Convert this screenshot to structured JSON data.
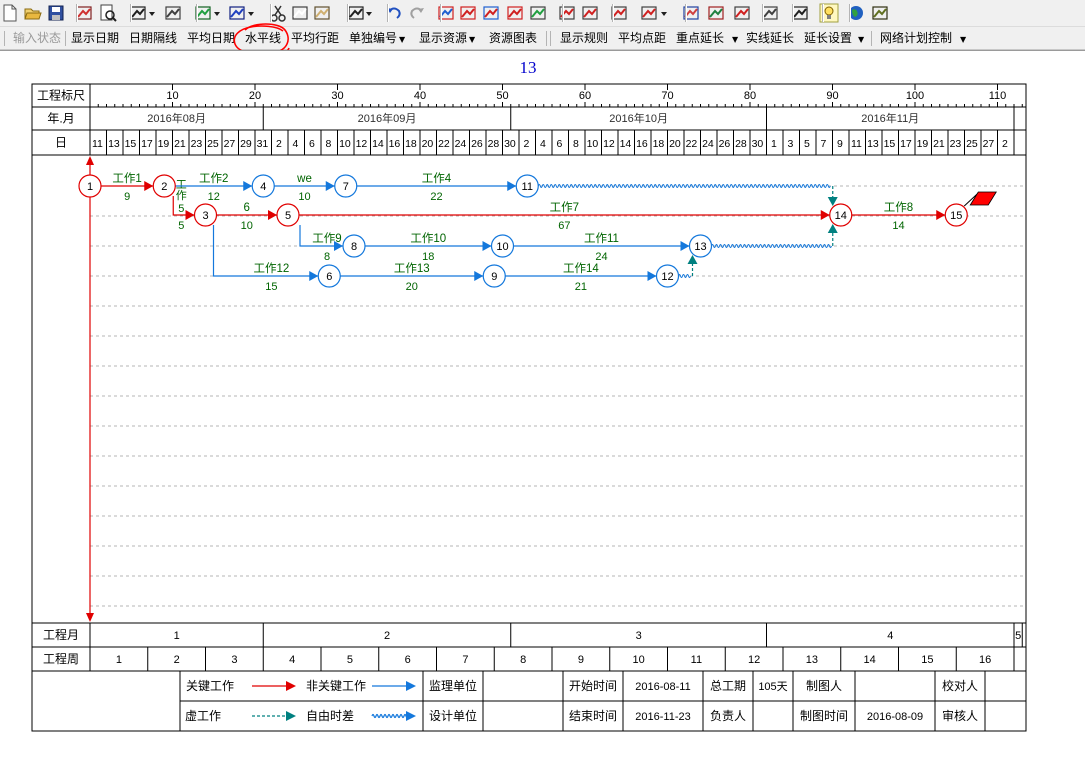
{
  "toolbar_icons": [
    "new-file-icon",
    "open-folder-icon",
    "save-icon",
    "export-icon",
    "print-preview-icon",
    "line-style-icon",
    "line-style-dropdown-icon",
    "indent-icon",
    "refresh-icon",
    "refresh-dropdown-icon",
    "check-icon",
    "check-dropdown-icon",
    "cut-icon",
    "copy-icon",
    "paste-icon",
    "find-icon",
    "find-dropdown-icon",
    "undo-icon",
    "redo-icon",
    "network-icon",
    "critical-path-icon",
    "stack-icon",
    "curve-icon",
    "resource-icon",
    "link-nodes-icon",
    "unlink-nodes-icon",
    "calendar-icon",
    "align-icon",
    "align-dropdown-icon",
    "library-icon",
    "tools-icon",
    "edit-icon",
    "screen-icon",
    "move-icon",
    "light-bulb-icon",
    "globe-icon",
    "box-icon"
  ],
  "toolbar2": {
    "input_status": "输入状态",
    "show_date": "显示日期",
    "date_divider": "日期隔线",
    "average_date": "平均日期",
    "horizontal_line": "水平线",
    "average_row_spacing": "平均行距",
    "single_numbering": "单独编号",
    "show_resources": "显示资源",
    "resource_chart": "资源图表",
    "show_rules": "显示规则",
    "average_point_spacing": "平均点距",
    "key_extend": "重点延长",
    "solid_extend": "实线延长",
    "extend_settings": "延长设置",
    "network_control": "网络计划控制"
  },
  "title": "13",
  "scale": {
    "label": "工程标尺",
    "ticks": [
      "10",
      "20",
      "30",
      "40",
      "50",
      "60",
      "70",
      "80",
      "90",
      "100",
      "110"
    ],
    "tick_values": [
      10,
      20,
      30,
      40,
      50,
      60,
      70,
      80,
      90,
      100,
      110
    ]
  },
  "year_month": {
    "label": "年.月",
    "months": [
      {
        "label": "2016年08月",
        "from": 0,
        "to": 21
      },
      {
        "label": "2016年09月",
        "from": 21,
        "to": 51
      },
      {
        "label": "2016年10月",
        "from": 51,
        "to": 82
      },
      {
        "label": "2016年11月",
        "from": 82,
        "to": 112
      }
    ]
  },
  "day_row": {
    "label": "日",
    "days": [
      "11",
      "13",
      "15",
      "17",
      "19",
      "21",
      "23",
      "25",
      "27",
      "29",
      "31",
      "2",
      "4",
      "6",
      "8",
      "10",
      "12",
      "14",
      "16",
      "18",
      "20",
      "22",
      "24",
      "26",
      "28",
      "30",
      "2",
      "4",
      "6",
      "8",
      "10",
      "12",
      "14",
      "16",
      "18",
      "20",
      "22",
      "24",
      "26",
      "28",
      "30",
      "1",
      "3",
      "5",
      "7",
      "9",
      "11",
      "13",
      "15",
      "17",
      "19",
      "21",
      "23",
      "25",
      "27",
      "2"
    ]
  },
  "footer_rows": {
    "month_label": "工程月",
    "project_months": [
      {
        "label": "1",
        "from": 0,
        "to": 21
      },
      {
        "label": "2",
        "from": 21,
        "to": 51
      },
      {
        "label": "3",
        "from": 51,
        "to": 82
      },
      {
        "label": "4",
        "from": 82,
        "to": 112
      },
      {
        "label": "5",
        "from": 112,
        "to": 113
      }
    ],
    "week_label": "工程周",
    "weeks": [
      "1",
      "2",
      "3",
      "4",
      "5",
      "6",
      "7",
      "8",
      "9",
      "10",
      "11",
      "12",
      "13",
      "14",
      "15",
      "16"
    ]
  },
  "legend": {
    "critical_work": "关键工作",
    "noncritical_work": "非关键工作",
    "dummy_work": "虚工作",
    "free_float": "自由时差",
    "supervision_unit": "监理单位",
    "design_unit": "设计单位",
    "start_time_label": "开始时间",
    "start_time": "2016-08-11",
    "end_time_label": "结束时间",
    "end_time": "2016-11-23",
    "total_duration_label": "总工期",
    "total_duration": "105天",
    "responsible_label": "负责人",
    "drawer_label": "制图人",
    "draw_time_label": "制图时间",
    "draw_time": "2016-08-09",
    "checker_label": "校对人",
    "reviewer_label": "审核人"
  },
  "colors": {
    "critical": "#e00000",
    "noncritical": "#1478dc",
    "dummy": "#008080",
    "label": "#006400",
    "annotation": "#ff0000"
  },
  "network": {
    "nodes": [
      {
        "id": "1",
        "day": 0,
        "row": 0,
        "critical": true
      },
      {
        "id": "2",
        "day": 9,
        "row": 0,
        "critical": true
      },
      {
        "id": "3",
        "day": 14,
        "row": 1,
        "critical": true
      },
      {
        "id": "4",
        "day": 21,
        "row": 0,
        "critical": false
      },
      {
        "id": "5",
        "day": 24,
        "row": 1,
        "critical": true
      },
      {
        "id": "6",
        "day": 29,
        "row": 3,
        "critical": false
      },
      {
        "id": "7",
        "day": 31,
        "row": 0,
        "critical": false
      },
      {
        "id": "8",
        "day": 32,
        "row": 2,
        "critical": false
      },
      {
        "id": "9",
        "day": 49,
        "row": 3,
        "critical": false
      },
      {
        "id": "10",
        "day": 50,
        "row": 2,
        "critical": false
      },
      {
        "id": "11",
        "day": 53,
        "row": 0,
        "critical": false
      },
      {
        "id": "12",
        "day": 70,
        "row": 3,
        "critical": false
      },
      {
        "id": "13",
        "day": 74,
        "row": 2,
        "critical": false
      },
      {
        "id": "14",
        "day": 91,
        "row": 1,
        "critical": true
      },
      {
        "id": "15",
        "day": 105,
        "row": 1,
        "critical": true
      }
    ],
    "works": [
      {
        "from": "1",
        "to": "2",
        "name": "工作1",
        "duration": "9",
        "critical": true
      },
      {
        "from": "2",
        "to": "3",
        "name": "工作",
        "duration": "5",
        "critical": true
      },
      {
        "from": "2",
        "to": "4",
        "name": "工作2",
        "duration": "12",
        "critical": false
      },
      {
        "from": "3",
        "to": "5",
        "name": "6",
        "duration": "10",
        "critical": true
      },
      {
        "from": "4",
        "to": "7",
        "name": "we",
        "duration": "10",
        "critical": false
      },
      {
        "from": "7",
        "to": "11",
        "name": "工作4",
        "duration": "22",
        "critical": false
      },
      {
        "from": "5",
        "to": "14",
        "name": "工作7",
        "duration": "67",
        "critical": true
      },
      {
        "from": "5",
        "to": "8",
        "name": "工作9",
        "duration": "8",
        "critical": false
      },
      {
        "from": "8",
        "to": "10",
        "name": "工作10",
        "duration": "18",
        "critical": false
      },
      {
        "from": "10",
        "to": "13",
        "name": "工作11",
        "duration": "24",
        "critical": false
      },
      {
        "from": "3",
        "to": "6",
        "name": "工作12",
        "duration": "15",
        "critical": false
      },
      {
        "from": "6",
        "to": "9",
        "name": "工作13",
        "duration": "20",
        "critical": false
      },
      {
        "from": "9",
        "to": "12",
        "name": "工作14",
        "duration": "21",
        "critical": false
      },
      {
        "from": "14",
        "to": "15",
        "name": "工作8",
        "duration": "14",
        "critical": true
      }
    ],
    "dummies": [
      {
        "from": "11",
        "to": "14"
      },
      {
        "from": "12",
        "to": "13"
      },
      {
        "from": "13",
        "to": "14"
      }
    ],
    "side_duration": "5"
  }
}
